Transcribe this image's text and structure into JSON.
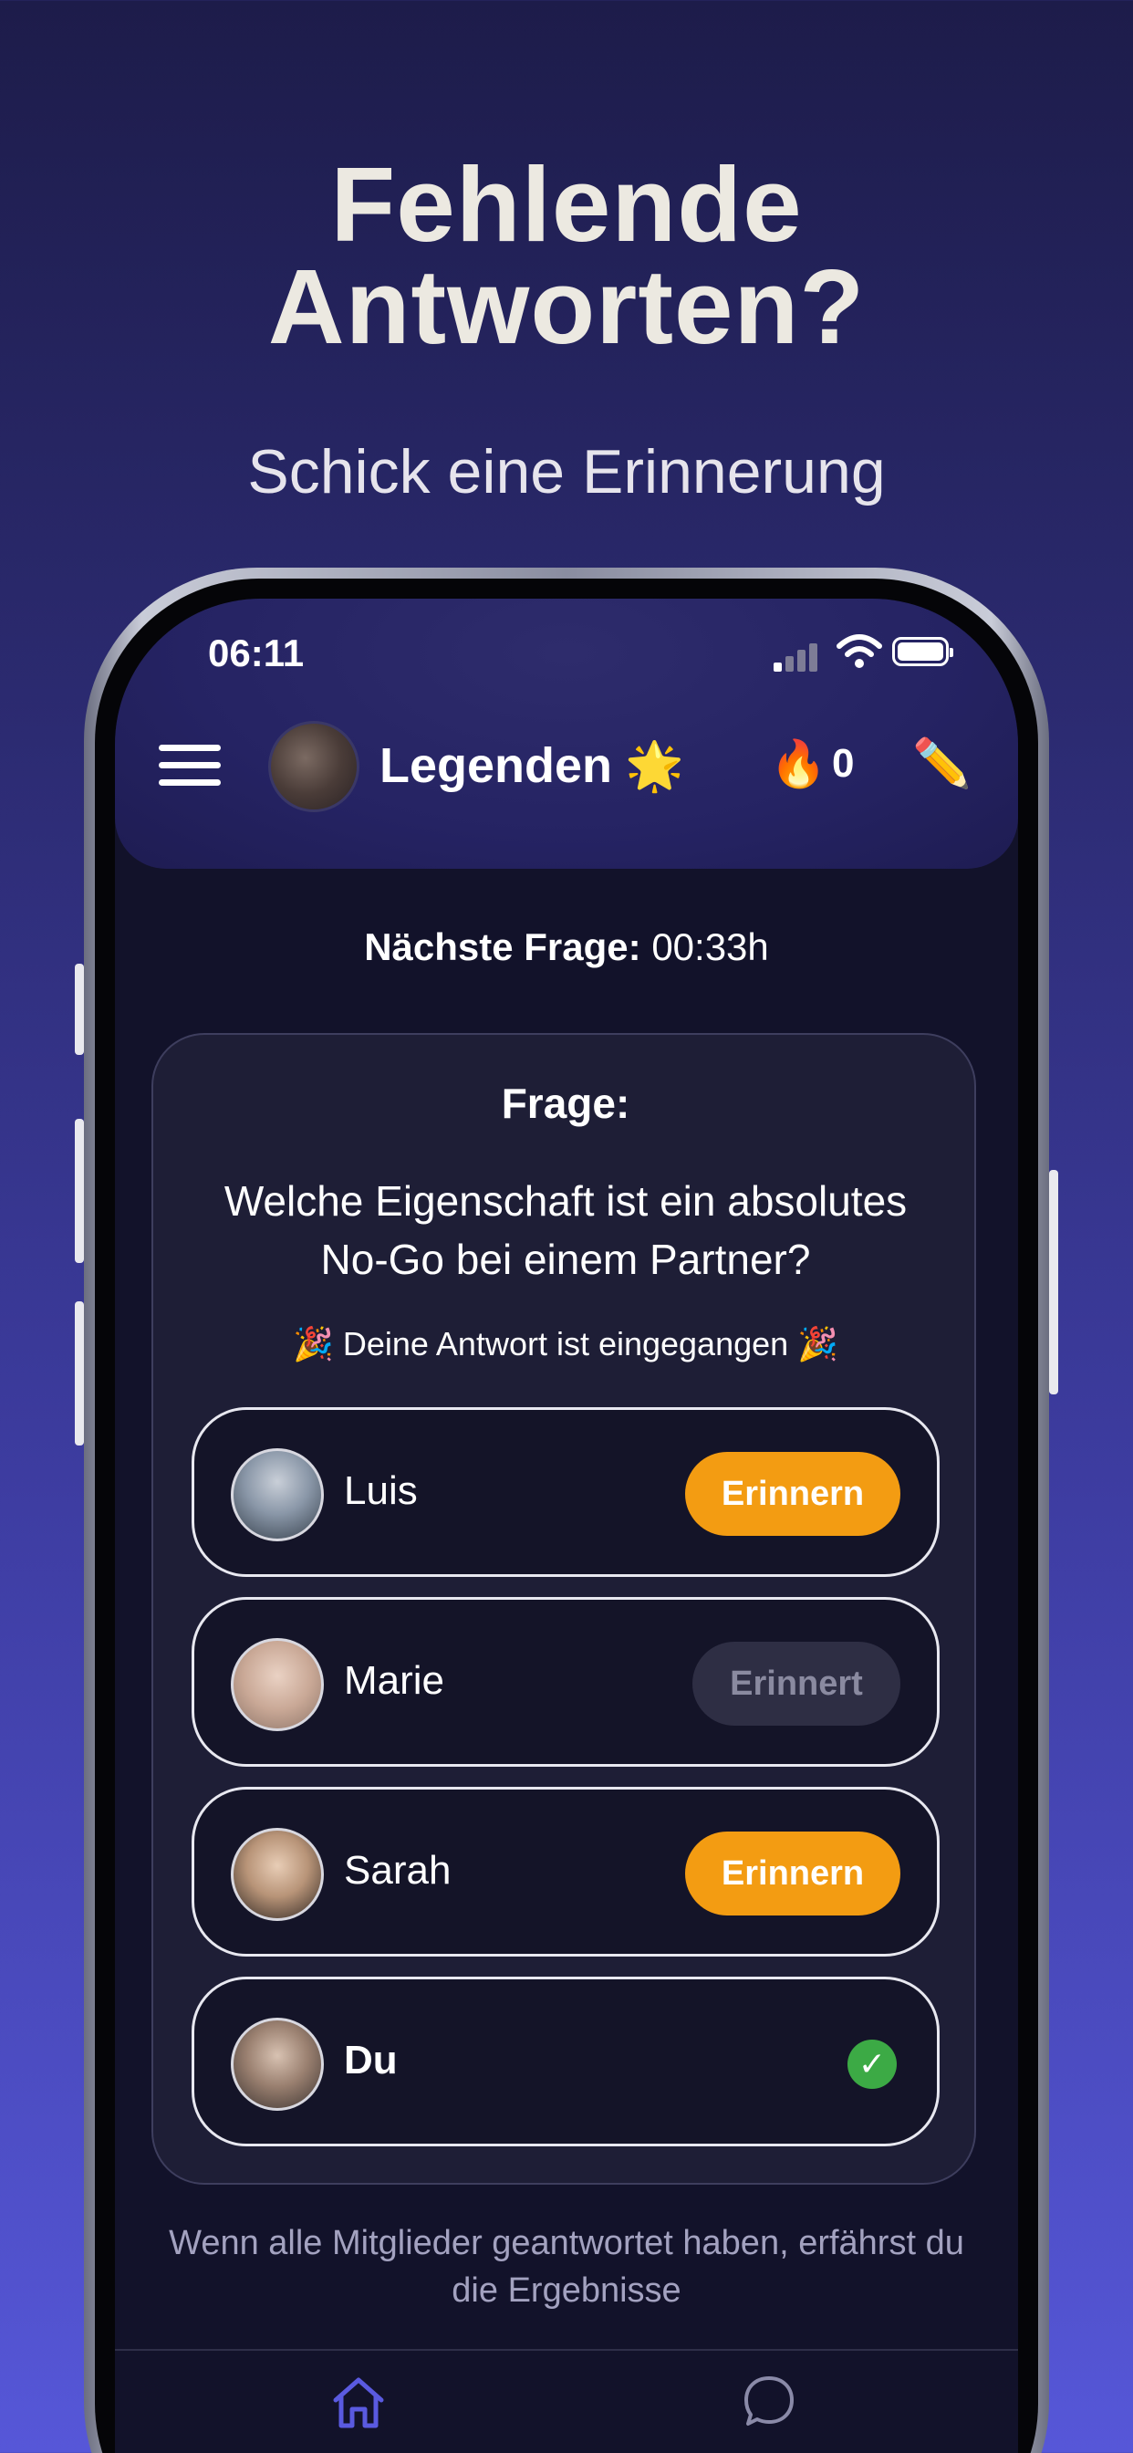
{
  "promo": {
    "headline_line1": "Fehlende",
    "headline_line2": "Antworten?",
    "subline": "Schick eine Erinnerung"
  },
  "status_bar": {
    "time": "06:11"
  },
  "header": {
    "group_name": "Legenden",
    "group_emoji": "🌟",
    "fire_emoji": "🔥",
    "streak_count": "0",
    "edit_emoji": "✏️"
  },
  "countdown": {
    "label": "Nächste Frage:",
    "value": "00:33h"
  },
  "question_card": {
    "label": "Frage:",
    "question": "Welche Eigenschaft ist ein absolutes No-Go bei einem Partner?",
    "answered_emoji": "🎉",
    "answered_text": "Deine Antwort ist eingegangen"
  },
  "members": [
    {
      "name": "Luis",
      "action": "Erinnern",
      "state": "remind"
    },
    {
      "name": "Marie",
      "action": "Erinnert",
      "state": "reminded"
    },
    {
      "name": "Sarah",
      "action": "Erinnern",
      "state": "remind"
    },
    {
      "name": "Du",
      "action": "",
      "state": "answered",
      "check": "✓"
    }
  ],
  "footer_note": "Wenn alle Mitglieder geantwortet haben, erfährst du die Ergebnisse",
  "colors": {
    "accent_orange": "#f39c12",
    "success_green": "#3caa45",
    "tab_active": "#5a5ae0"
  },
  "tab_bar": {
    "icons": [
      "home-icon",
      "chat-icon"
    ]
  }
}
